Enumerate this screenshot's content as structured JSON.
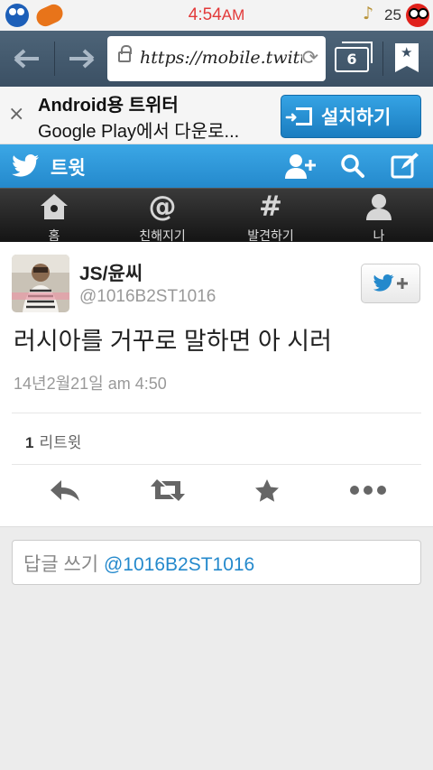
{
  "status_bar": {
    "time": "4:54",
    "ampm": "AM",
    "battery": "25",
    "icons": [
      "cookie-monster-icon",
      "cookie-icon",
      "music-note-icon",
      "elmo-icon"
    ]
  },
  "browser": {
    "url": "https://mobile.twitter",
    "tab_count": "6",
    "icons": [
      "back-arrow-icon",
      "forward-arrow-icon",
      "lock-icon",
      "reload-icon",
      "tabs-icon",
      "bookmark-icon"
    ]
  },
  "banner": {
    "title": "Android용 트위터",
    "subtitle": "Google Play에서 다운로...",
    "install_label": "설치하기",
    "close_glyph": "×"
  },
  "twitter_header": {
    "title": "트윗",
    "icons": [
      "twitter-bird-icon",
      "add-user-icon",
      "search-icon",
      "compose-icon"
    ]
  },
  "nav": {
    "items": [
      {
        "label": "홈",
        "icon": "home-icon"
      },
      {
        "label": "친해지기",
        "icon": "at-sign-icon",
        "glyph": "@"
      },
      {
        "label": "발견하기",
        "icon": "hashtag-icon",
        "glyph": "#"
      },
      {
        "label": "나",
        "icon": "person-icon"
      }
    ]
  },
  "tweet": {
    "author_name": "JS/윤씨",
    "author_handle": "@1016B2ST1016",
    "text": "러시아를 거꾸로 말하면 아 시러",
    "timestamp": "14년2월21일 am 4:50",
    "retweet_count": "1",
    "retweet_label": "리트윗",
    "actions": [
      "reply-icon",
      "retweet-icon",
      "favorite-icon",
      "more-icon"
    ]
  },
  "reply": {
    "placeholder_prefix": "답글 쓰기",
    "mention": "@1016B2ST1016"
  },
  "colors": {
    "twitter_blue": "#2489cc",
    "install_blue": "#1b7dc0",
    "status_time_red": "#e23a3a",
    "browser_bar": "#3b5064",
    "nav_dark": "#1e1e1e"
  }
}
